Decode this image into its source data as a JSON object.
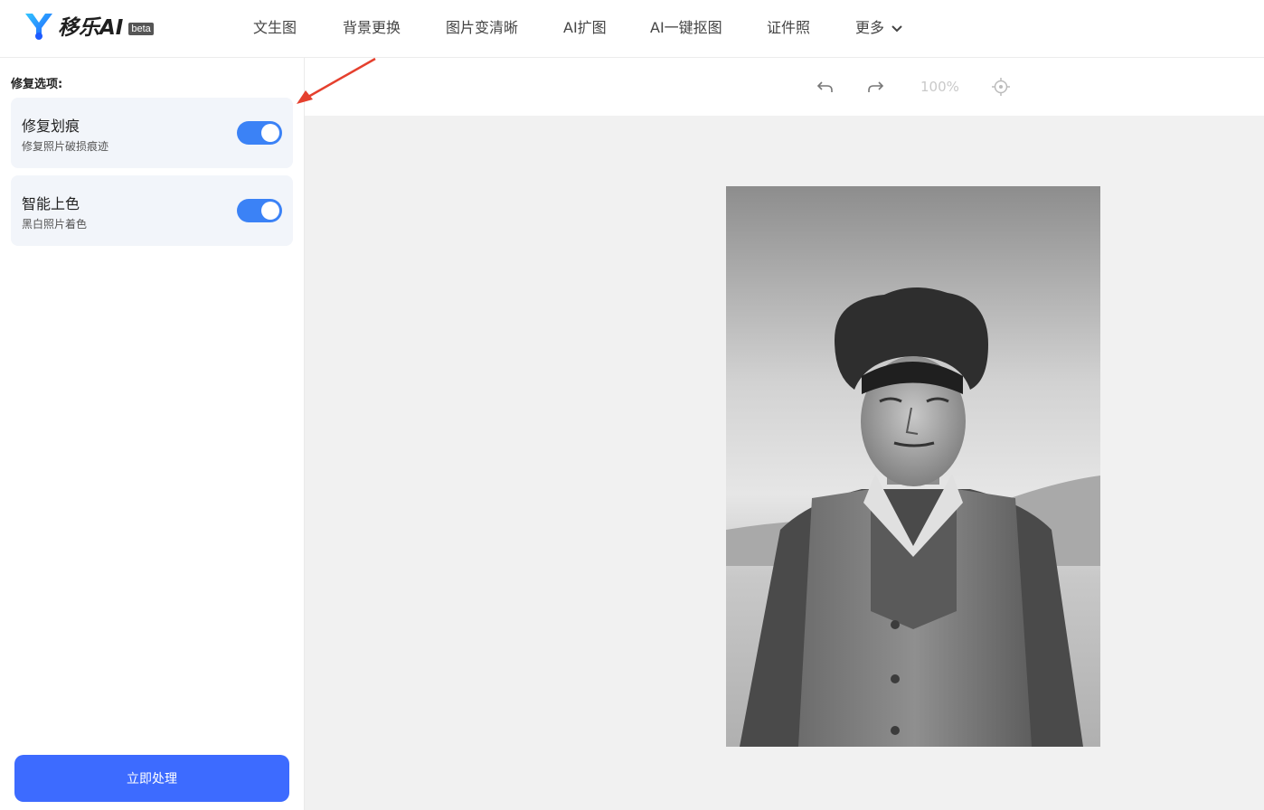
{
  "brand": {
    "name": "移乐AI",
    "badge": "beta"
  },
  "nav": {
    "items": [
      "文生图",
      "背景更换",
      "图片变清晰",
      "AI扩图",
      "AI一键抠图",
      "证件照"
    ],
    "more": "更多"
  },
  "sidebar": {
    "section_title": "修复选项:",
    "options": [
      {
        "title": "修复划痕",
        "desc": "修复照片破损痕迹",
        "enabled": true
      },
      {
        "title": "智能上色",
        "desc": "黑白照片着色",
        "enabled": true
      }
    ],
    "process_button": "立即处理"
  },
  "toolbar": {
    "zoom": "100%"
  },
  "colors": {
    "accent": "#3b82f6",
    "button": "#3d6bff",
    "arrow": "#e5402e"
  },
  "icons": [
    "undo-icon",
    "redo-icon",
    "recenter-icon",
    "chevron-down-icon"
  ]
}
